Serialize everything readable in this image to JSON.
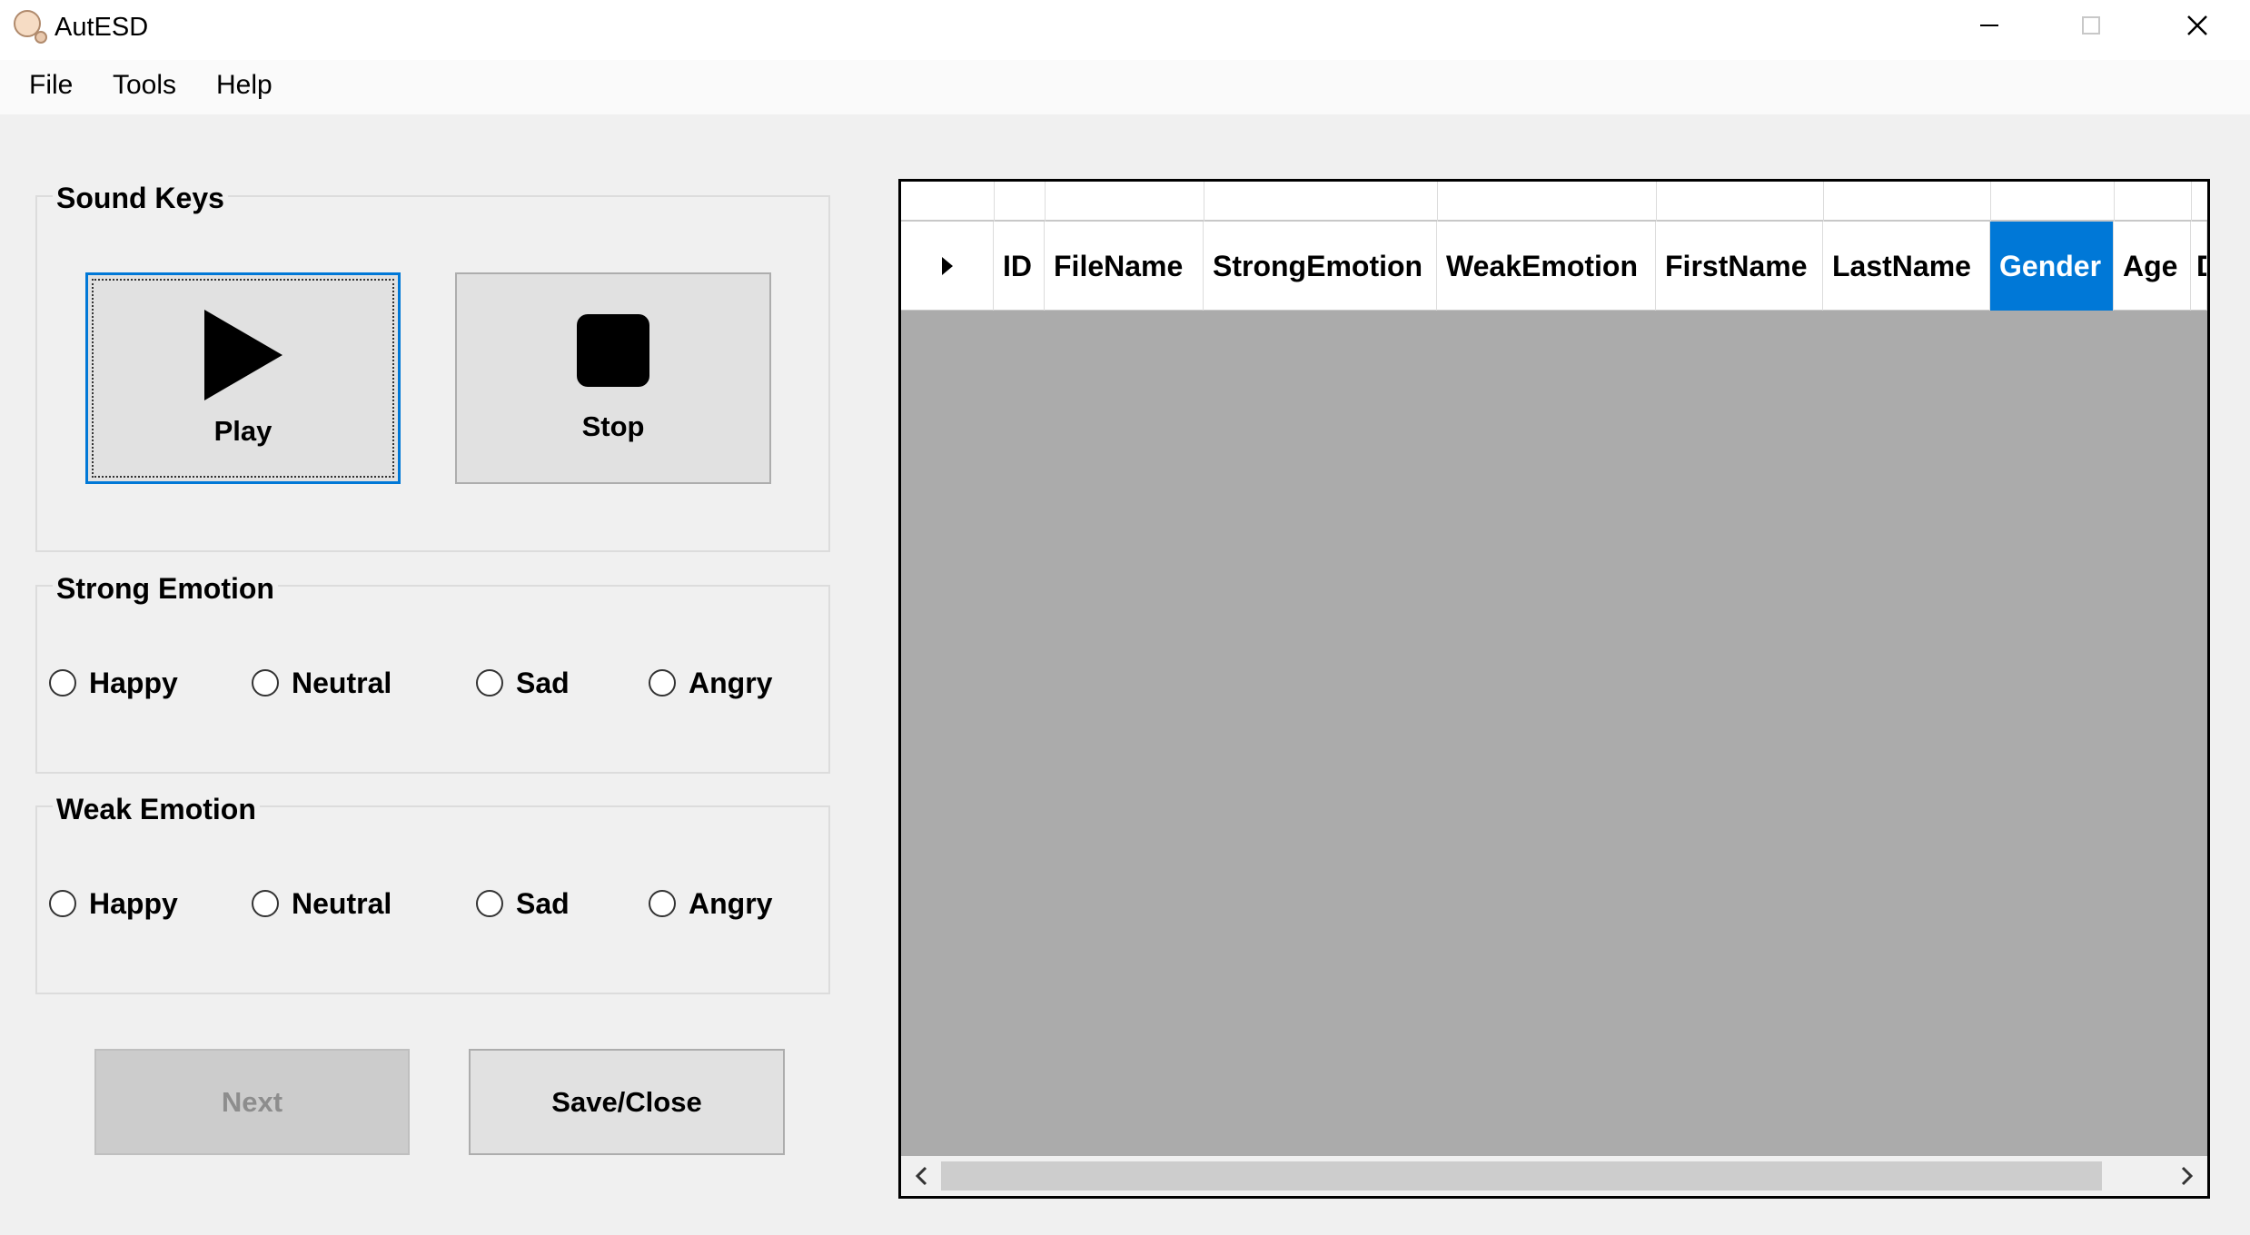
{
  "window": {
    "title": "AutESD"
  },
  "menu": {
    "items": [
      "File",
      "Tools",
      "Help"
    ]
  },
  "sound_keys": {
    "title": "Sound Keys",
    "play_label": "Play",
    "stop_label": "Stop"
  },
  "strong_emotion": {
    "title": "Strong Emotion",
    "options": [
      "Happy",
      "Neutral",
      "Sad",
      "Angry"
    ]
  },
  "weak_emotion": {
    "title": "Weak Emotion",
    "options": [
      "Happy",
      "Neutral",
      "Sad",
      "Angry"
    ]
  },
  "actions": {
    "next_label": "Next",
    "save_close_label": "Save/Close"
  },
  "grid": {
    "columns": [
      "ID",
      "FileName",
      "StrongEmotion",
      "WeakEmotion",
      "FirstName",
      "LastName",
      "Gender",
      "Age",
      "D"
    ],
    "selected_column": "Gender"
  },
  "colors": {
    "accent": "#0078d7",
    "grid_background": "#ababab",
    "window_background": "#f0f0f0"
  }
}
